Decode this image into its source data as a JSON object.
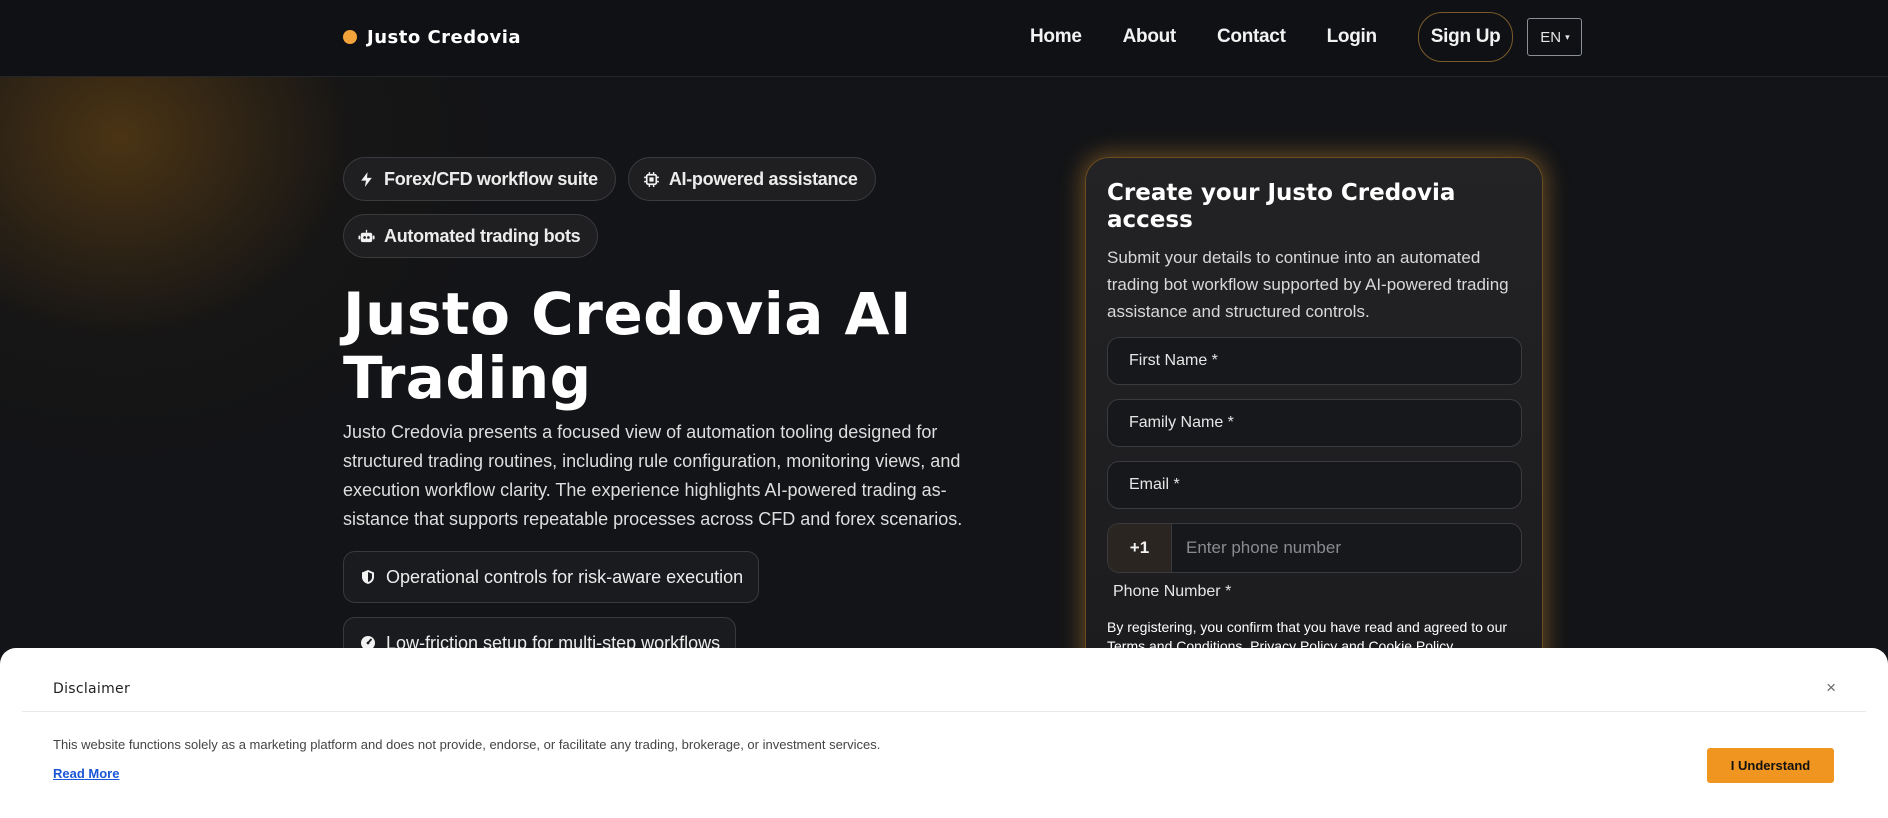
{
  "header": {
    "brand": "Justo Credovia",
    "nav": [
      "Home",
      "About",
      "Contact",
      "Login"
    ],
    "signup": "Sign Up",
    "language": "EN"
  },
  "hero": {
    "badges": [
      "Forex/CFD workflow suite",
      "AI-powered assistance",
      "Automated trading bots"
    ],
    "title": "Justo Credovia AI Trading",
    "description": "Justo Credovia presents a focused view of automation tooling designed for structured trading routines, including rule configuration, monitoring views, and execution workflow clarity. The experience highlights AI-powered trading as­sistance that supports repeatable processes across CFD and forex scenarios.",
    "features": [
      "Operational controls for risk-aware execution",
      "Low-friction setup for multi-step workflows"
    ]
  },
  "form": {
    "title": "Create your Justo Credovia access",
    "subtitle": "Submit your details to continue into an automated trading bot workflow supported by AI-powered trading assistance and structured controls.",
    "first_name": "First Name *",
    "family_name": "Family Name *",
    "email": "Email *",
    "phone_code": "+1",
    "phone_placeholder": "Enter phone number",
    "phone_label": "Phone Number *",
    "terms": "By registering, you confirm that you have read and agreed to our Terms and Conditions, Privacy Policy and Cookie Policy."
  },
  "disclaimer": {
    "title": "Disclaimer",
    "close": "×",
    "text": "This website functions solely as a marketing platform and does not provide, endorse, or facilitate any trading, brokerage, or investment services.",
    "read_more": "Read More",
    "button": "I Understand"
  },
  "colors": {
    "accent": "#f2a33a",
    "button": "#f0951f",
    "background": "#131417"
  }
}
